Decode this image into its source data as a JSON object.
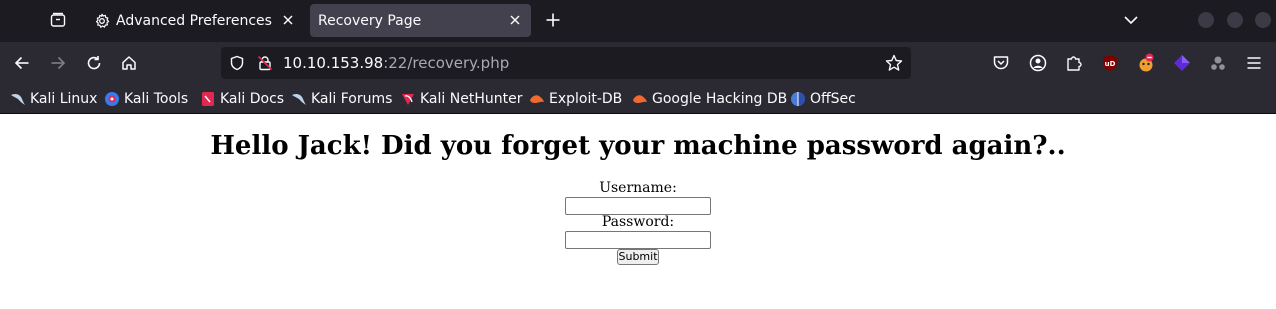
{
  "tabs": [
    {
      "title": "Advanced Preferences",
      "icon": "gear-icon",
      "active": false
    },
    {
      "title": "Recovery Page",
      "icon": "none",
      "active": true
    }
  ],
  "navbar": {
    "url_host": "10.10.153.98",
    "url_rest": ":22/recovery.php"
  },
  "bookmarks": [
    {
      "label": "Kali Linux",
      "icon": "kali-dragon-icon"
    },
    {
      "label": "Kali Tools",
      "icon": "kali-tools-icon"
    },
    {
      "label": "Kali Docs",
      "icon": "kali-docs-icon"
    },
    {
      "label": "Kali Forums",
      "icon": "kali-dragon-icon"
    },
    {
      "label": "Kali NetHunter",
      "icon": "nethunter-icon"
    },
    {
      "label": "Exploit-DB",
      "icon": "exploit-db-icon"
    },
    {
      "label": "Google Hacking DB",
      "icon": "exploit-db-icon"
    },
    {
      "label": "OffSec",
      "icon": "offsec-icon"
    }
  ],
  "page": {
    "heading": "Hello Jack! Did you forget your machine password again?..",
    "username_label": "Username:",
    "password_label": "Password:",
    "submit_label": "Submit",
    "username_value": "",
    "password_value": ""
  },
  "colors": {
    "tabstrip_bg": "#1c1b22",
    "toolbar_bg": "#2b2a33",
    "active_tab_bg": "#42414d",
    "url_text": "#fbfbfe"
  }
}
